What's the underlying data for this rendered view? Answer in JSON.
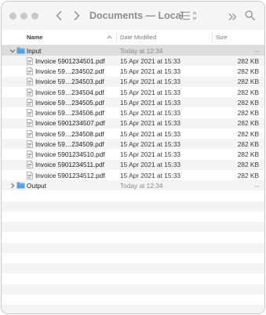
{
  "window": {
    "title": "Documents — Local"
  },
  "header": {
    "name": "Name",
    "date": "Date Modified",
    "size": "Size"
  },
  "rows": [
    {
      "kind": "folder",
      "name": "Input",
      "date": "Today at 12:34",
      "size": "--",
      "expanded": true
    },
    {
      "kind": "file",
      "name": "Invoice 5901234501.pdf",
      "date": "15 Apr 2021 at 15:33",
      "size": "282 KB"
    },
    {
      "kind": "file",
      "name": "Invoice 59…234502.pdf",
      "date": "15 Apr 2021 at 15:33",
      "size": "282 KB"
    },
    {
      "kind": "file",
      "name": "Invoice 59…234503.pdf",
      "date": "15 Apr 2021 at 15:33",
      "size": "282 KB"
    },
    {
      "kind": "file",
      "name": "Invoice 59…234504.pdf",
      "date": "15 Apr 2021 at 15:33",
      "size": "282 KB"
    },
    {
      "kind": "file",
      "name": "Invoice 59…234505.pdf",
      "date": "15 Apr 2021 at 15:33",
      "size": "282 KB"
    },
    {
      "kind": "file",
      "name": "Invoice 59…234506.pdf",
      "date": "15 Apr 2021 at 15:33",
      "size": "282 KB"
    },
    {
      "kind": "file",
      "name": "Invoice 5901234507.pdf",
      "date": "15 Apr 2021 at 15:33",
      "size": "282 KB"
    },
    {
      "kind": "file",
      "name": "Invoice 59…234508.pdf",
      "date": "15 Apr 2021 at 15:33",
      "size": "282 KB"
    },
    {
      "kind": "file",
      "name": "Invoice 59…234509.pdf",
      "date": "15 Apr 2021 at 15:33",
      "size": "282 KB"
    },
    {
      "kind": "file",
      "name": "Invoice 5901234510.pdf",
      "date": "15 Apr 2021 at 15:33",
      "size": "282 KB"
    },
    {
      "kind": "file",
      "name": "Invoice 5901234511.pdf",
      "date": "15 Apr 2021 at 15:33",
      "size": "282 KB"
    },
    {
      "kind": "file",
      "name": "Invoice 5901234512.pdf",
      "date": "15 Apr 2021 at 15:33",
      "size": "282 KB"
    },
    {
      "kind": "folder",
      "name": "Output",
      "date": "Today at 12:34",
      "size": "--",
      "expanded": false
    }
  ],
  "colors": {
    "folder": "#4fa3e8",
    "selected_row": "#dcdcdc",
    "stripe": "#f4f4f4"
  }
}
